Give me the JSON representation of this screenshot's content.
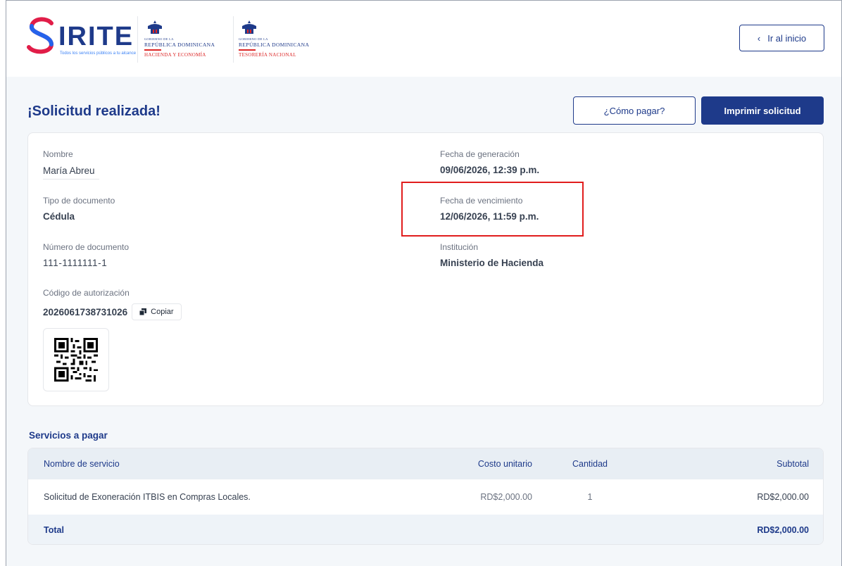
{
  "header": {
    "logo": {
      "wordmark": "IRITE",
      "tagline": "Todos los servicios públicos a tu alcance"
    },
    "gov_logos": [
      {
        "gobierno": "GOBIERNO DE LA",
        "republica": "REPÚBLICA DOMINICANA",
        "institucion": "HACIENDA Y ECONOMÍA"
      },
      {
        "gobierno": "GOBIERNO DE LA",
        "republica": "REPÚBLICA DOMINICANA",
        "institucion": "TESORERÍA NACIONAL"
      }
    ],
    "home_button": "Ir al inicio"
  },
  "page": {
    "title": "¡Solicitud realizada!",
    "how_to_pay_button": "¿Cómo pagar?",
    "print_button": "Imprimir solicitud"
  },
  "details": {
    "nombre": {
      "label": "Nombre",
      "value": "María Abreu"
    },
    "tipo_documento": {
      "label": "Tipo de documento",
      "value": "Cédula"
    },
    "numero_documento": {
      "label": "Número de documento",
      "value": "111-1111111-1"
    },
    "codigo_autorizacion": {
      "label": "Código de autorización",
      "value": "2026061738731026",
      "copy_label": "Copiar"
    },
    "fecha_generacion": {
      "label": "Fecha de generación",
      "value": "09/06/2026, 12:39 p.m."
    },
    "fecha_vencimiento": {
      "label": "Fecha de vencimiento",
      "value": "12/06/2026, 11:59 p.m."
    },
    "institucion": {
      "label": "Institución",
      "value": "Ministerio de Hacienda"
    }
  },
  "services": {
    "title": "Servicios a pagar",
    "columns": [
      "Nombre de servicio",
      "Costo unitario",
      "Cantidad",
      "Subtotal"
    ],
    "rows": [
      {
        "name": "Solicitud de Exoneración ITBIS en Compras Locales.",
        "unit_cost": "RD$2,000.00",
        "quantity": "1",
        "subtotal": "RD$2,000.00"
      }
    ],
    "total_label": "Total",
    "total_value": "RD$2,000.00"
  },
  "colors": {
    "primary": "#1e3a8a",
    "highlight": "#e11d1d",
    "background": "#f4f7fa"
  }
}
